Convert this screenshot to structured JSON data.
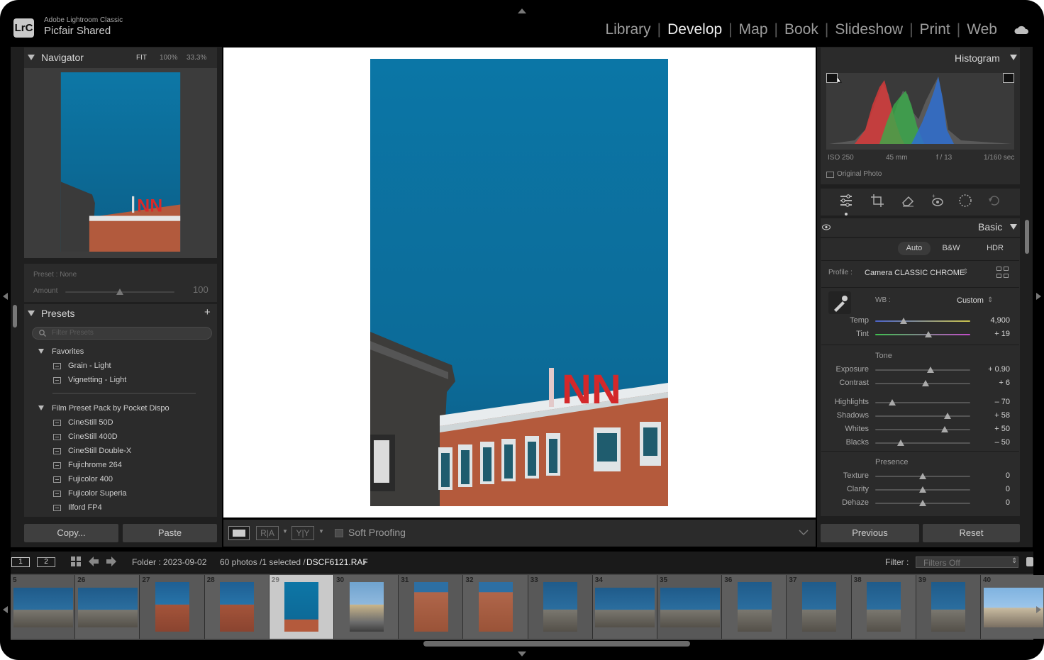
{
  "header": {
    "app_name": "Adobe Lightroom Classic",
    "catalog": "Picfair Shared",
    "logo": "LrC",
    "modules": [
      "Library",
      "Develop",
      "Map",
      "Book",
      "Slideshow",
      "Print",
      "Web"
    ],
    "active_module": "Develop"
  },
  "navigator": {
    "title": "Navigator",
    "zoom_fit": "FIT",
    "zoom_100": "100%",
    "zoom_333": "33.3%"
  },
  "preset_amount": {
    "preset_label": "Preset : None",
    "amount_label": "Amount",
    "amount_value": "100",
    "amount_fraction": 0.5
  },
  "presets": {
    "title": "Presets",
    "filter_placeholder": "Filter Presets",
    "groups": [
      {
        "name": "Favorites",
        "items": [
          "Grain - Light",
          "Vignetting - Light"
        ]
      },
      {
        "name": "Film Preset Pack by Pocket Dispo",
        "items": [
          "CineStill 50D",
          "CineStill 400D",
          "CineStill Double-X",
          "Fujichrome 264",
          "Fujicolor 400",
          "Fujicolor Superia",
          "Ilford FP4"
        ]
      }
    ]
  },
  "left_buttons": {
    "copy": "Copy...",
    "paste": "Paste"
  },
  "toolbar": {
    "soft_proofing": "Soft Proofing"
  },
  "histogram": {
    "title": "Histogram",
    "iso": "ISO 250",
    "focal": "45 mm",
    "aperture": "f / 13",
    "shutter": "1/160 sec",
    "original_photo": "Original Photo"
  },
  "basic": {
    "title": "Basic",
    "auto": "Auto",
    "bw": "B&W",
    "hdr": "HDR",
    "profile_label": "Profile :",
    "profile_value": "Camera CLASSIC CHROME",
    "wb_label": "WB :",
    "wb_value": "Custom",
    "tone_label": "Tone",
    "presence_label": "Presence",
    "sliders": [
      {
        "label": "Temp",
        "value": "4,900",
        "pos": 0.3
      },
      {
        "label": "Tint",
        "value": "+ 19",
        "pos": 0.56
      },
      {
        "label": "Exposure",
        "value": "+ 0.90",
        "pos": 0.58
      },
      {
        "label": "Contrast",
        "value": "+ 6",
        "pos": 0.53
      },
      {
        "label": "Highlights",
        "value": "– 70",
        "pos": 0.18
      },
      {
        "label": "Shadows",
        "value": "+ 58",
        "pos": 0.76
      },
      {
        "label": "Whites",
        "value": "+ 50",
        "pos": 0.73
      },
      {
        "label": "Blacks",
        "value": "– 50",
        "pos": 0.27
      },
      {
        "label": "Texture",
        "value": "0",
        "pos": 0.5
      },
      {
        "label": "Clarity",
        "value": "0",
        "pos": 0.5
      },
      {
        "label": "Dehaze",
        "value": "0",
        "pos": 0.5
      }
    ]
  },
  "right_buttons": {
    "previous": "Previous",
    "reset": "Reset"
  },
  "filmstrip_bar": {
    "page1": "1",
    "page2": "2",
    "folder": "Folder : 2023-09-02",
    "count": "60 photos /1 selected /",
    "filename": "DSCF6121.RAF",
    "filter_label": "Filter :",
    "filter_value": "Filters Off"
  },
  "filmstrip": {
    "numbers": [
      "5",
      "26",
      "27",
      "28",
      "29",
      "30",
      "31",
      "32",
      "33",
      "34",
      "35",
      "36",
      "37",
      "38",
      "39",
      "40"
    ],
    "selected": "29"
  },
  "colors": {
    "sky": "#0f6a97",
    "brick": "#b45a3c",
    "bg": "#2b2b2b"
  }
}
